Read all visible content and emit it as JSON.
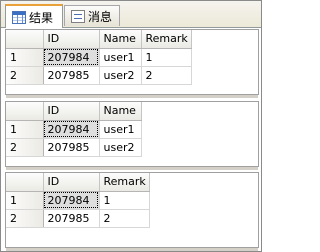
{
  "tabs": [
    {
      "label": "结果",
      "icon": "grid-icon"
    },
    {
      "label": "消息",
      "icon": "message-icon"
    }
  ],
  "results": [
    {
      "columns": [
        "ID",
        "Name",
        "Remark"
      ],
      "rows": [
        {
          "num": "1",
          "cells": [
            "207984",
            "user1",
            "1"
          ]
        },
        {
          "num": "2",
          "cells": [
            "207985",
            "user2",
            "2"
          ]
        }
      ]
    },
    {
      "columns": [
        "ID",
        "Name"
      ],
      "rows": [
        {
          "num": "1",
          "cells": [
            "207984",
            "user1"
          ]
        },
        {
          "num": "2",
          "cells": [
            "207985",
            "user2"
          ]
        }
      ]
    },
    {
      "columns": [
        "ID",
        "Remark"
      ],
      "rows": [
        {
          "num": "1",
          "cells": [
            "207984",
            "1"
          ]
        },
        {
          "num": "2",
          "cells": [
            "207985",
            "2"
          ]
        }
      ]
    }
  ]
}
